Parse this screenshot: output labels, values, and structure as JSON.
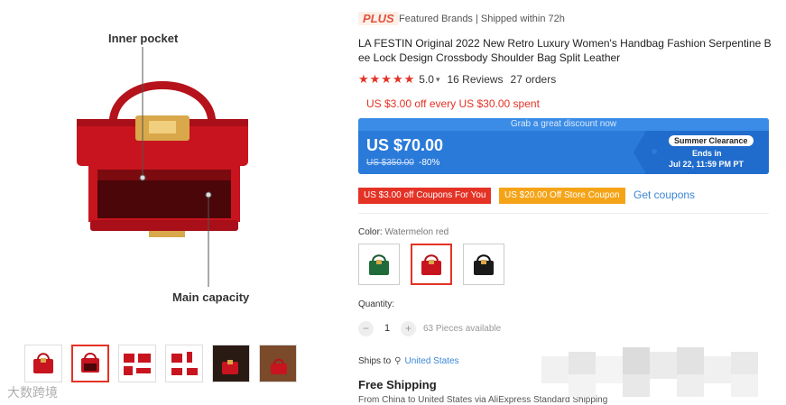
{
  "gallery": {
    "callouts": [
      "Inner pocket",
      "Main capacity"
    ],
    "thumbnail_count": 6,
    "active_thumbnail": 1,
    "watermark": "大数跨境"
  },
  "product": {
    "plus_badge": "PLUS",
    "brand_line": "Featured Brands | Shipped within 72h",
    "title": "LA FESTIN Original 2022 New Retro Luxury Women's Handbag Fashion Serpentine Bee Lock Design Crossbody Shoulder Bag Split Leather",
    "rating_stars": "★★★★★",
    "rating_value": "5.0",
    "reviews": "16 Reviews",
    "orders": "27 orders",
    "promo_text": "US $3.00 off every US $30.00 spent"
  },
  "price": {
    "banner_title": "Grab a great discount now",
    "current": "US $70.00",
    "original": "US $350.00",
    "discount": "-80%",
    "sale_badge": "Summer Clearance",
    "ends_label": "Ends in",
    "ends_date": "Jul 22, 11:59 PM PT"
  },
  "coupons": {
    "coupon1": "US $3.00 off Coupons For You",
    "coupon2": "US $20.00 Off Store Coupon",
    "get_coupons": "Get coupons"
  },
  "color": {
    "label": "Color:",
    "selected": "Watermelon red",
    "options": [
      "green",
      "red",
      "black"
    ]
  },
  "quantity": {
    "label": "Quantity:",
    "minus": "−",
    "value": "1",
    "plus": "+",
    "available": "63 Pieces available"
  },
  "shipping": {
    "ships_to_label": "Ships to",
    "country": "United States",
    "free_shipping": "Free Shipping",
    "detail": "From China to United States via AliExpress Standard Shipping"
  },
  "colors": {
    "accent_red": "#e43225",
    "banner_blue": "#2a7ad9",
    "coupon_orange": "#f5a418",
    "link_blue": "#3b86d6",
    "bag_red": "#c8141e"
  }
}
